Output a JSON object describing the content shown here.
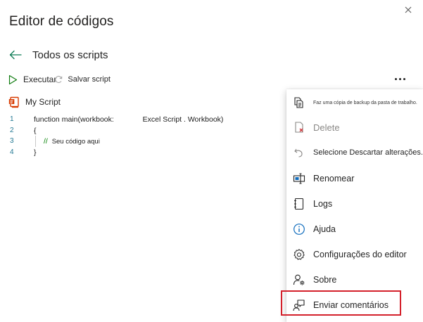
{
  "pane": {
    "title": "Editor de códigos",
    "close_icon": "close-icon"
  },
  "nav": {
    "back_label": "Todos os scripts",
    "back_icon": "arrow-left-icon"
  },
  "toolbar": {
    "run_label": "Executar",
    "run_icon": "play-icon",
    "save_label": "Salvar script",
    "save_icon": "save-sync-icon",
    "more_icon": "more-horizontal-icon"
  },
  "script": {
    "name": "My Script",
    "icon": "script-file-icon"
  },
  "editor": {
    "lines": [
      {
        "num": "1",
        "text": "function main(workbook:              Excel Script . Workbook)"
      },
      {
        "num": "2",
        "text": "{"
      },
      {
        "num": "3",
        "comment_slashes": "//",
        "comment_text": "Seu código aqui"
      },
      {
        "num": "4",
        "text": "}"
      }
    ]
  },
  "menu": {
    "items": [
      {
        "label": "Faz uma cópia de backup da pasta de trabalho.",
        "icon": "copy-document-icon"
      },
      {
        "label": "Delete",
        "icon": "delete-document-icon",
        "disabled": true
      },
      {
        "label": "Selecione Descartar alterações.",
        "icon": "undo-icon"
      },
      {
        "label": "Renomear",
        "icon": "rename-icon"
      },
      {
        "label": "Logs",
        "icon": "notebook-icon"
      },
      {
        "label": "Ajuda",
        "icon": "info-icon"
      },
      {
        "label": "Configurações do editor",
        "icon": "gear-icon"
      },
      {
        "label": "Sobre",
        "icon": "person-settings-icon"
      },
      {
        "label": "Enviar comentários",
        "icon": "feedback-person-icon"
      }
    ]
  },
  "colors": {
    "accent": "#0f6cbd",
    "run_green": "#107c10",
    "script_orange": "#d83b01",
    "highlight": "#d4202b"
  }
}
